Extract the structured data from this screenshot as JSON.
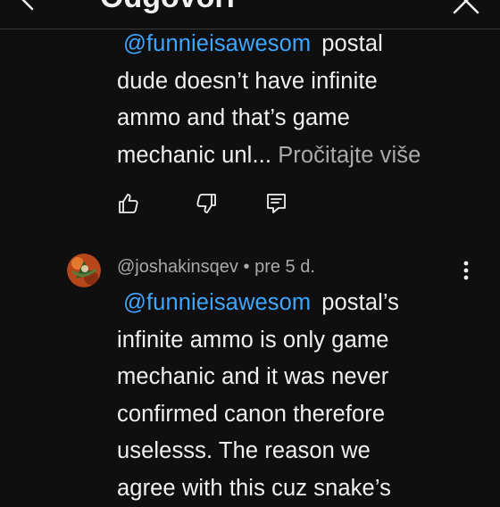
{
  "header": {
    "title": "Odgovori"
  },
  "reply_1": {
    "mention": "@funnieisawesom",
    "text_line1": "postal",
    "text_rest": [
      "dude doesn’t have infinite",
      "ammo and that’s game",
      "mechanic unl..."
    ],
    "read_more": "Pročitajte više",
    "actions": [
      "like-icon",
      "dislike-icon",
      "reply-icon"
    ]
  },
  "reply_2": {
    "author": "@joshakinsqev",
    "separator": "•",
    "time": "pre 5 d.",
    "mention": "@funnieisawesom",
    "text_line1": "postal’s",
    "text_rest": [
      "infinite ammo is only game",
      "mechanic and it was never",
      "confirmed canon therefore",
      "uselesss. The reason we",
      "agree with this cuz snake’s"
    ]
  },
  "colors": {
    "background": "#0f0f0f",
    "text": "#f1f1f1",
    "mention": "#3ea6ff",
    "secondary": "#aaaaaa"
  }
}
